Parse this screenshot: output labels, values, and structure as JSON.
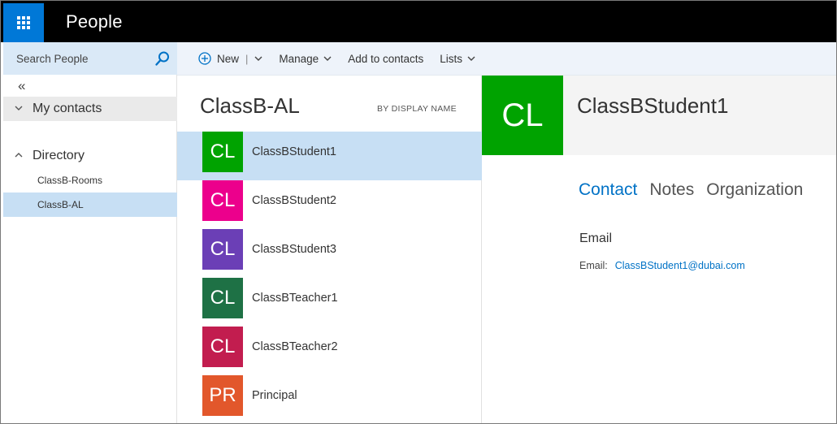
{
  "header": {
    "app_title": "People",
    "waffle_icon": "waffle-grid-icon",
    "accent": "#0078d7"
  },
  "leftnav": {
    "search_placeholder": "Search People",
    "collapse_label": "«",
    "my_contacts": "My contacts",
    "directory": "Directory",
    "directory_items": [
      "ClassB-Rooms",
      "ClassB-AL"
    ],
    "selected_item": "ClassB-AL"
  },
  "commands": {
    "new": "New",
    "separator": "|",
    "manage": "Manage",
    "add_to_contacts": "Add to contacts",
    "lists": "Lists"
  },
  "list": {
    "title": "ClassB-AL",
    "sort_label": "BY DISPLAY NAME",
    "rows": [
      {
        "initials": "CL",
        "name": "ClassBStudent1",
        "color": "#00a300",
        "selected": true
      },
      {
        "initials": "CL",
        "name": "ClassBStudent2",
        "color": "#ec008c",
        "selected": false
      },
      {
        "initials": "CL",
        "name": "ClassBStudent3",
        "color": "#6b3fb6",
        "selected": false
      },
      {
        "initials": "CL",
        "name": "ClassBTeacher1",
        "color": "#1e7145",
        "selected": false
      },
      {
        "initials": "CL",
        "name": "ClassBTeacher2",
        "color": "#c21d4f",
        "selected": false
      },
      {
        "initials": "PR",
        "name": "Principal",
        "color": "#e2572b",
        "selected": false
      }
    ]
  },
  "detail": {
    "initials": "CL",
    "name": "ClassBStudent1",
    "avatar_color": "#00a300",
    "tabs": [
      "Contact",
      "Notes",
      "Organization"
    ],
    "active_tab": "Contact",
    "section_title": "Email",
    "email_label": "Email:",
    "email_value": "ClassBStudent1@dubai.com"
  }
}
